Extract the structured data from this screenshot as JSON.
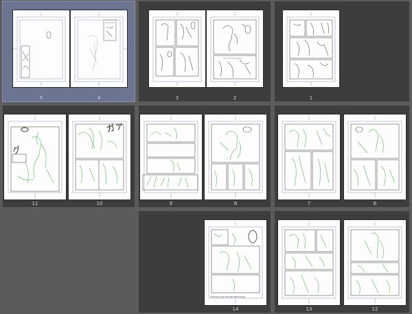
{
  "thumbnails": [
    {
      "label": "5"
    },
    {
      "label": "4"
    },
    {
      "label": "3"
    },
    {
      "label": "2"
    },
    {
      "label": "1"
    },
    {
      "label": "11"
    },
    {
      "label": "10"
    },
    {
      "label": "9"
    },
    {
      "label": "8"
    },
    {
      "label": "7"
    },
    {
      "label": "6"
    },
    {
      "label": "14"
    },
    {
      "label": "13"
    },
    {
      "label": "12"
    }
  ],
  "colors": {
    "background": "#5b5b5b",
    "spread": "#3d3d3d",
    "selected_spread": "#6b7591",
    "sketch_green": "#4fb84f",
    "ink_gray": "#555555",
    "page_white": "#fdfdfd"
  },
  "pages": {
    "14": {
      "footer_text": "7200 Rew.AK.Ba.Wwa.BKx.W8nkL.B2gd"
    }
  },
  "selected_spread": "5-4"
}
